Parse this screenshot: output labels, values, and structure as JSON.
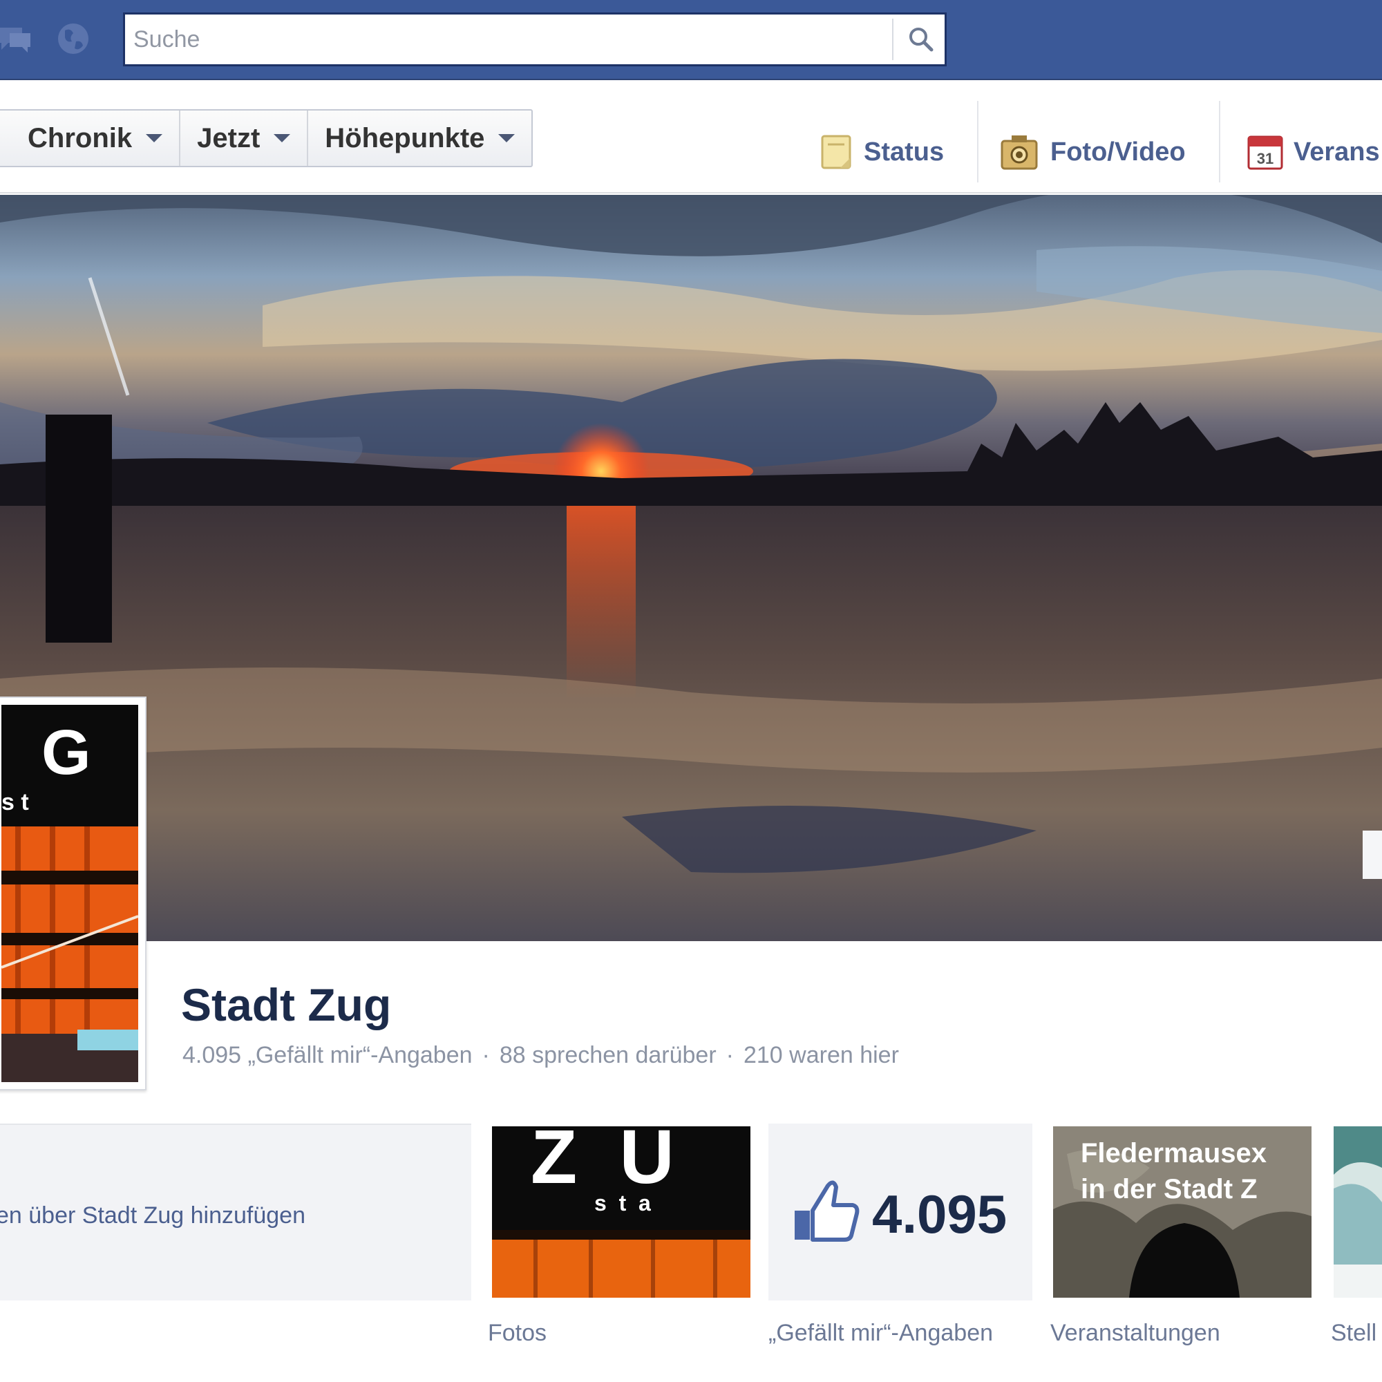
{
  "search": {
    "placeholder": "Suche"
  },
  "tabs": [
    {
      "label": "Chronik"
    },
    {
      "label": "Jetzt"
    },
    {
      "label": "Höhepunkte"
    }
  ],
  "composer": [
    {
      "label": "Status",
      "icon": "status-icon"
    },
    {
      "label": "Foto/Video",
      "icon": "photo-video-icon"
    },
    {
      "label": "Verans",
      "icon": "calendar-icon"
    }
  ],
  "calendar_day": "31",
  "profile": {
    "logo_letter": "G",
    "logo_sub": "s t"
  },
  "page": {
    "name": "Stadt Zug",
    "likes_stat": "4.095 „Gefällt mir“-Angaben",
    "talking_stat": "88 sprechen darüber",
    "were_here_stat": "210 waren hier",
    "separator": "·"
  },
  "about": {
    "link": "en über Stadt Zug hinzufügen"
  },
  "photos_thumb": {
    "letters": "Z  U",
    "sub": "s  t  a"
  },
  "likes": {
    "count": "4.095"
  },
  "events_thumb": {
    "line1": "Fledermausex",
    "line2": "in der Stadt Z"
  },
  "sections": [
    {
      "label": "Fotos"
    },
    {
      "label": "„Gefällt mir“-Angaben"
    },
    {
      "label": "Veranstaltungen"
    },
    {
      "label": "Stell"
    }
  ],
  "colors": {
    "facebook_blue": "#3b5998",
    "link": "#4b5f8f",
    "name": "#1c2b4a"
  }
}
